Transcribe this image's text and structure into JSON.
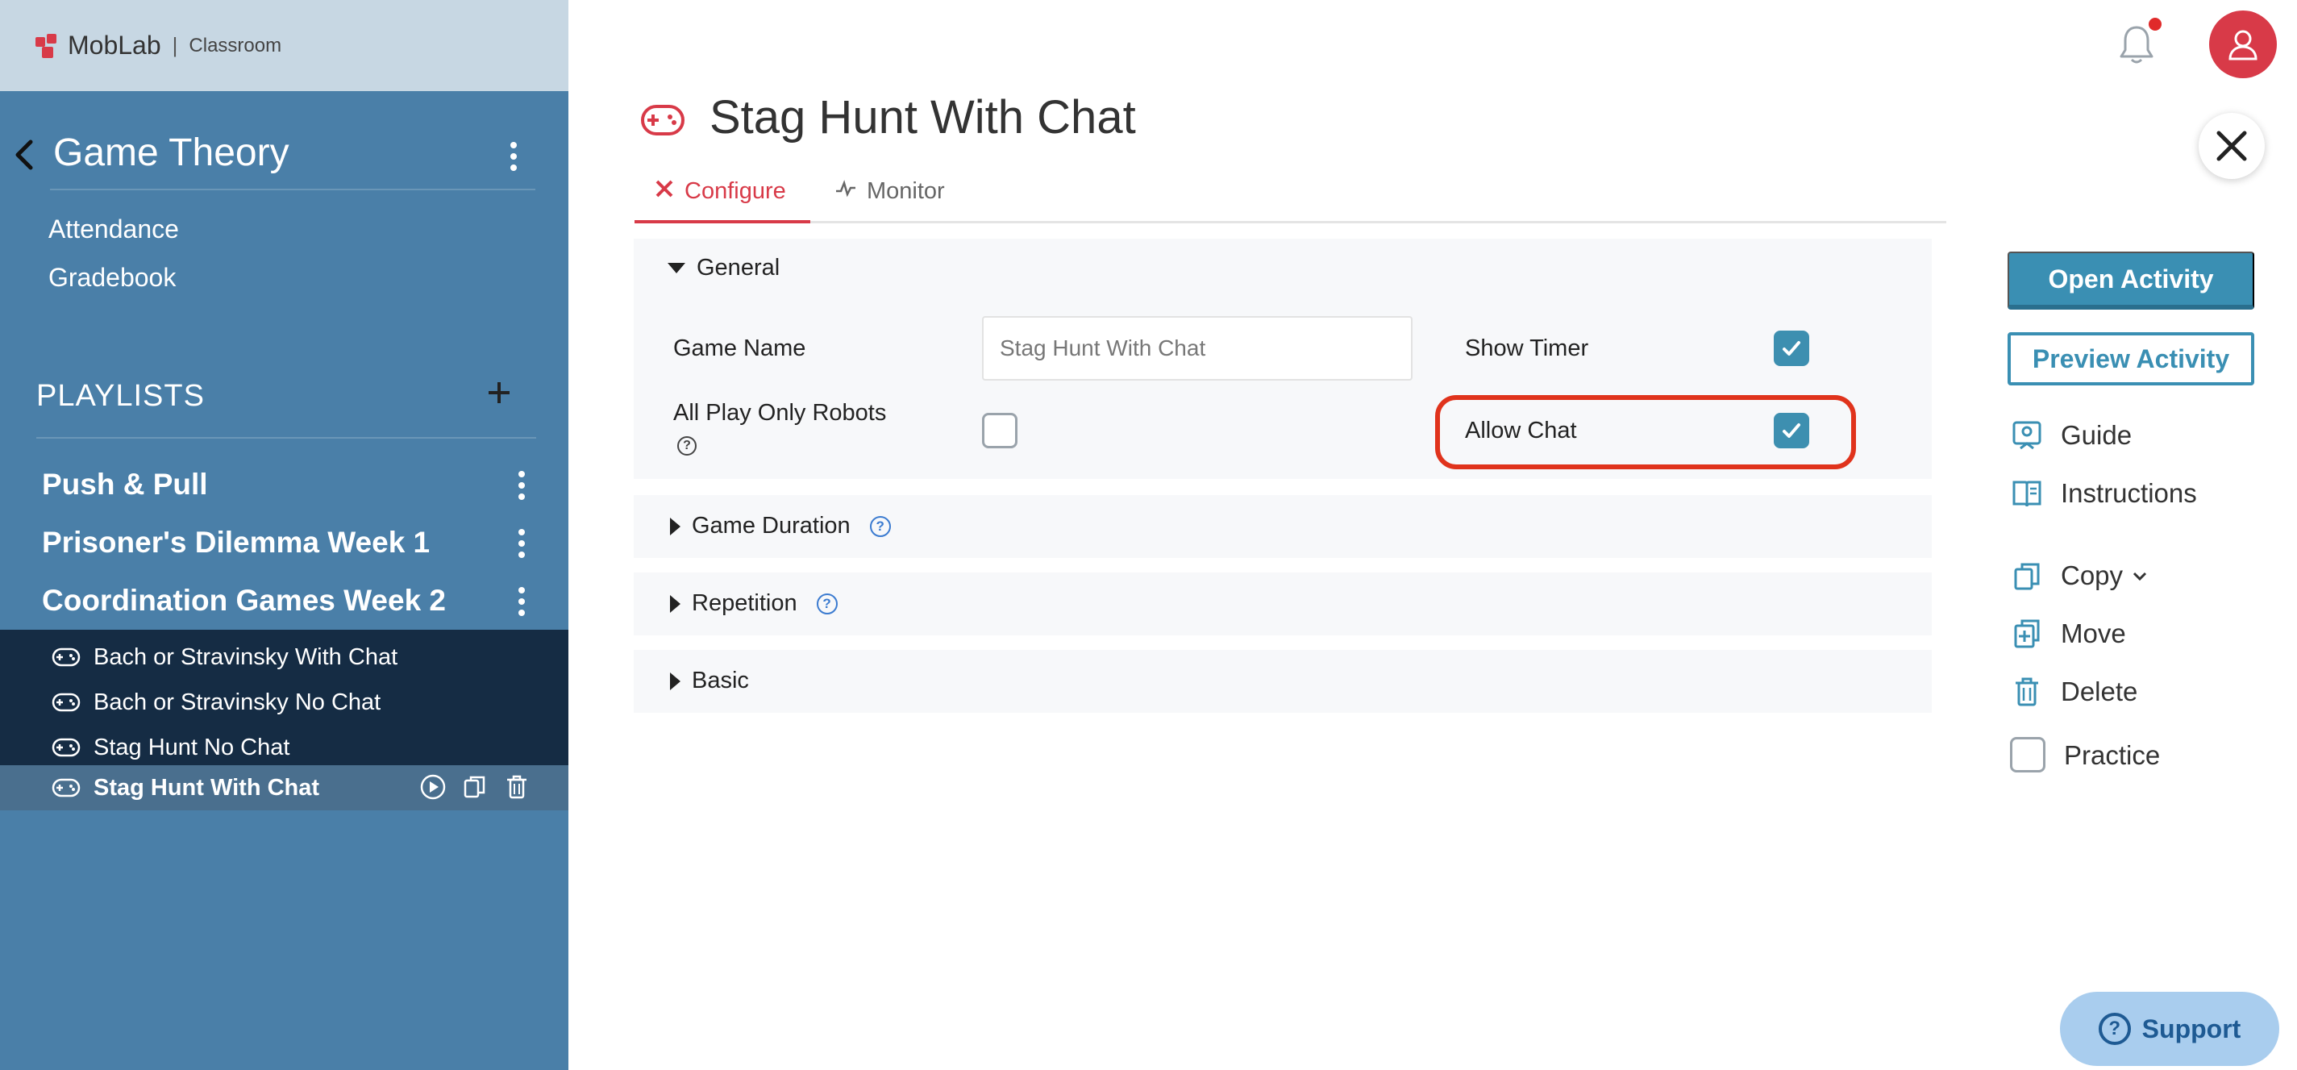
{
  "brand": {
    "name": "MobLab",
    "separator": "|",
    "product": "Classroom"
  },
  "sidebar": {
    "course_title": "Game Theory",
    "links": [
      "Attendance",
      "Gradebook"
    ],
    "playlists_heading": "PLAYLISTS",
    "playlists": [
      "Push & Pull",
      "Prisoner's Dilemma Week 1",
      "Coordination Games Week 2"
    ],
    "activities": [
      {
        "label": "Bach or Stravinsky With Chat",
        "selected": false
      },
      {
        "label": "Bach or Stravinsky No Chat",
        "selected": false
      },
      {
        "label": "Stag Hunt No Chat",
        "selected": false
      },
      {
        "label": "Stag Hunt With Chat",
        "selected": true
      }
    ]
  },
  "main": {
    "title": "Stag Hunt With Chat",
    "tabs": [
      {
        "label": "Configure",
        "active": true
      },
      {
        "label": "Monitor",
        "active": false
      }
    ],
    "sections": {
      "general": {
        "label": "General",
        "expanded": true,
        "fields": {
          "game_name_label": "Game Name",
          "game_name_value": "Stag Hunt With Chat",
          "show_timer_label": "Show Timer",
          "show_timer_checked": true,
          "all_play_only_robots_label": "All Play Only Robots",
          "all_play_only_robots_checked": false,
          "allow_chat_label": "Allow Chat",
          "allow_chat_checked": true
        }
      },
      "game_duration": {
        "label": "Game Duration",
        "expanded": false
      },
      "repetition": {
        "label": "Repetition",
        "expanded": false
      },
      "basic": {
        "label": "Basic",
        "expanded": false
      }
    }
  },
  "actions": {
    "open_activity": "Open Activity",
    "preview_activity": "Preview Activity",
    "guide": "Guide",
    "instructions": "Instructions",
    "copy": "Copy",
    "move": "Move",
    "delete": "Delete",
    "practice": "Practice",
    "practice_checked": false
  },
  "support": {
    "label": "Support",
    "glyph": "?"
  },
  "help_glyph": "?",
  "colors": {
    "sidebar_bg": "#4a7fa8",
    "brand_bar_bg": "#c7d7e3",
    "activity_list_bg": "#152c44",
    "accent_red": "#d83a48",
    "accent_teal": "#3a8fb3",
    "highlight_red": "#e0331c"
  }
}
